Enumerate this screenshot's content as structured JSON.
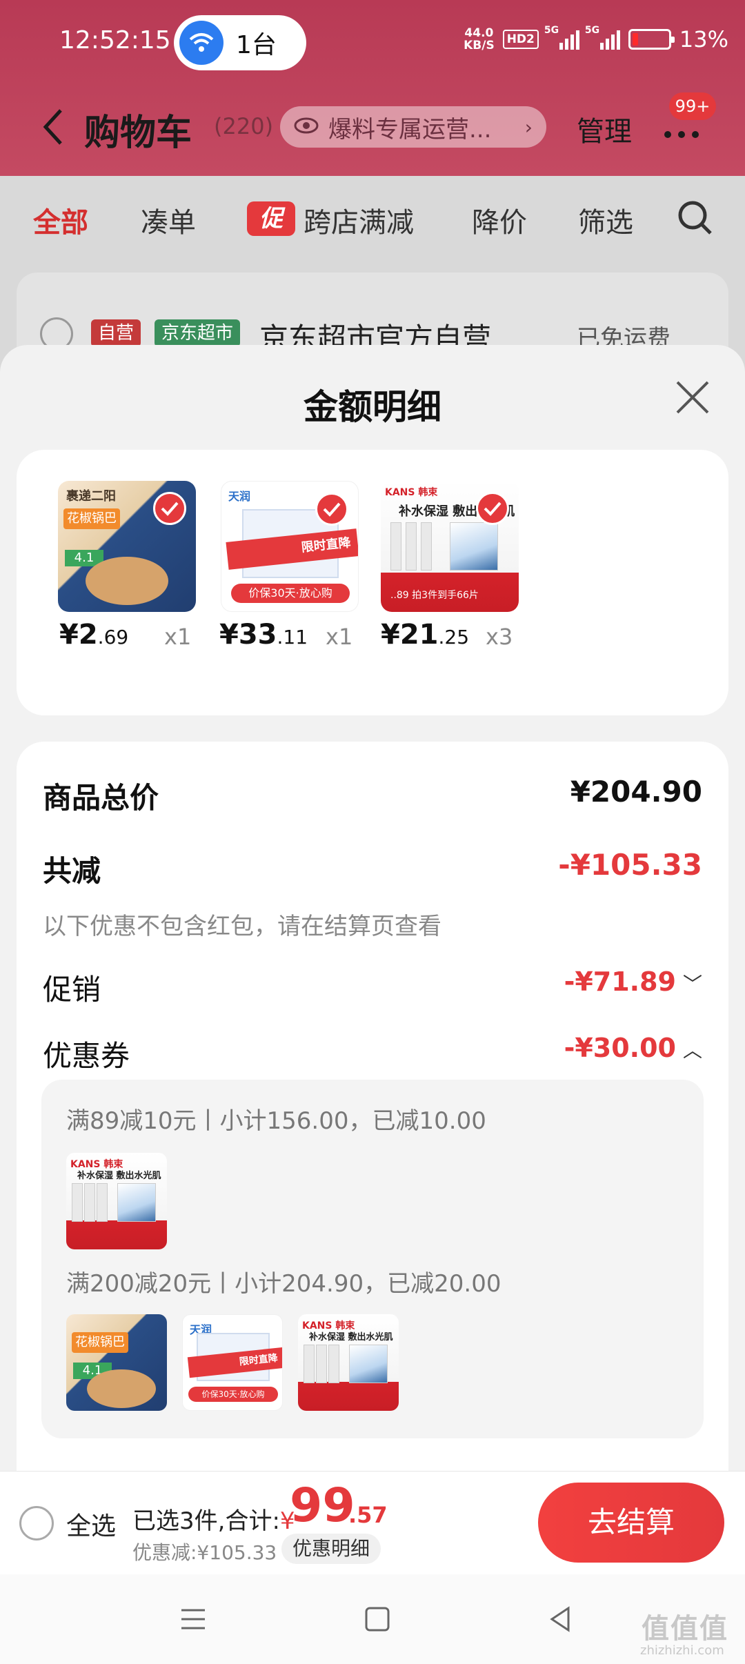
{
  "status_bar": {
    "time": "12:52:15",
    "cast_label": "1台",
    "net_speed_value": "44.0",
    "net_speed_unit": "KB/S",
    "hd_label": "HD2",
    "signal1_label": "5G",
    "signal2_label": "5G",
    "battery_percent": "13%"
  },
  "nav": {
    "title": "购物车",
    "count": "(220)",
    "scoop_label": "爆料专属运营...",
    "manage_label": "管理",
    "more_badge": "99+"
  },
  "tabs": {
    "all": "全部",
    "bundle": "凑单",
    "promo_tag": "促",
    "cross_store": "跨店满减",
    "price_drop": "降价",
    "filter": "筛选"
  },
  "store": {
    "tag_self": "自营",
    "tag_supermarket": "京东超市",
    "name": "京东超市官方自营",
    "shipping": "已免运费"
  },
  "sheet": {
    "title": "金额明细",
    "products": [
      {
        "price_int": "¥2",
        "price_dec": ".69",
        "qty": "x1"
      },
      {
        "price_int": "¥33",
        "price_dec": ".11",
        "qty": "x1"
      },
      {
        "price_int": "¥21",
        "price_dec": ".25",
        "qty": "x3"
      }
    ],
    "img_chips": {
      "brand": "裹递二阳",
      "tag": "花椒锅巴",
      "badge": "4.1"
    },
    "img_milk": {
      "logo": "天润",
      "ribbon": "限时直降",
      "foot": "价保30天·放心购"
    },
    "img_mask": {
      "logo": "KANS 韩束",
      "head": "补水保湿 敷出水光肌",
      "foot": "..89   拍3件到手66片"
    },
    "total_label": "商品总价",
    "total_value": "¥204.90",
    "reduce_label": "共减",
    "reduce_value": "-¥105.33",
    "reduce_note": "以下优惠不包含红包，请在结算页查看",
    "promo_label": "促销",
    "promo_value": "-¥71.89",
    "coupon_label": "优惠券",
    "coupon_value": "-¥30.00",
    "coupon_lines": [
      "满89减10元丨小计156.00，已减10.00",
      "满200减20元丨小计204.90，已减20.00"
    ]
  },
  "bottom": {
    "select_all": "全选",
    "summary": "已选3件,合计:",
    "currency": "¥",
    "total_int": "99",
    "total_dec": ".57",
    "discount": "优惠减:¥105.33",
    "detail_btn": "优惠明细",
    "checkout": "去结算"
  },
  "watermark": {
    "main": "值值值",
    "sub": "zhizhizhi.com"
  },
  "colors": {
    "accent": "#e4393c",
    "header": "#c44a62"
  }
}
